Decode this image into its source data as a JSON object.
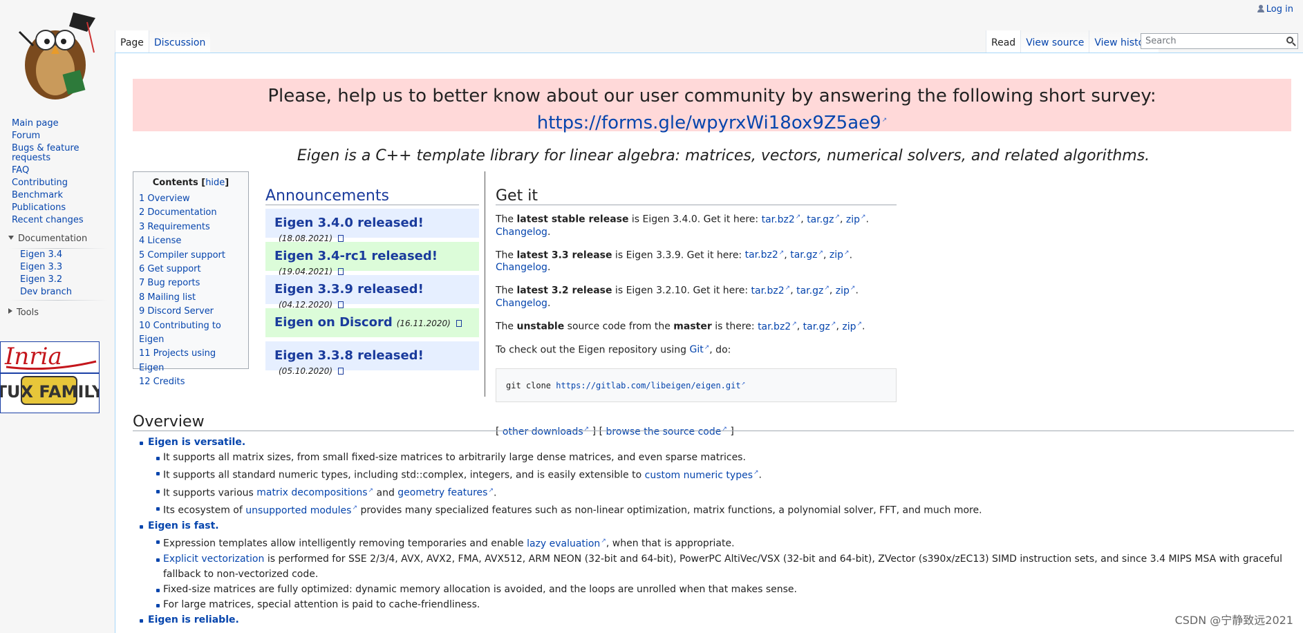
{
  "personal": {
    "login": "Log in"
  },
  "sidebar": {
    "nav": [
      "Main page",
      "Forum",
      "Bugs & feature requests",
      "FAQ",
      "Contributing",
      "Benchmark",
      "Publications",
      "Recent changes"
    ],
    "documentation_label": "Documentation",
    "documentation_items": [
      "Eigen 3.4",
      "Eigen 3.3",
      "Eigen 3.2",
      "Dev branch"
    ],
    "tools_label": "Tools",
    "sponsor1": "Inria",
    "sponsor2": "TUX FAMILY"
  },
  "tabs": {
    "left": [
      "Page",
      "Discussion"
    ],
    "right": [
      "Read",
      "View source",
      "View history"
    ]
  },
  "search": {
    "placeholder": "Search"
  },
  "survey": {
    "question": "Please, help us to better know about our user community by answering the following short survey:",
    "url": "https://forms.gle/wpyrxWi18ox9Z5ae9"
  },
  "tagline": "Eigen is a C++ template library for linear algebra: matrices, vectors, numerical solvers, and related algorithms.",
  "toc": {
    "title": "Contents",
    "hide": "hide",
    "items": [
      "1 Overview",
      "2 Documentation",
      "3 Requirements",
      "4 License",
      "5 Compiler support",
      "6 Get support",
      "7 Bug reports",
      "8 Mailing list",
      "9 Discord Server",
      "10 Contributing to Eigen",
      "11 Projects using Eigen",
      "12 Credits"
    ]
  },
  "announcements": {
    "title": "Announcements",
    "items": [
      {
        "label": "Eigen 3.4.0 released!",
        "date": "(18.08.2021)",
        "color": "#e6efff"
      },
      {
        "label": "Eigen 3.4-rc1 released!",
        "date": "(19.04.2021)",
        "color": "#dcfcd9"
      },
      {
        "label": "Eigen 3.3.9 released!",
        "date": "(04.12.2020)",
        "color": "#e6efff"
      },
      {
        "label": "Eigen on Discord",
        "date": "(16.11.2020)",
        "color": "#dcfcd9"
      },
      {
        "label": "Eigen 3.3.8 released!",
        "date": "(05.10.2020)",
        "color": "#e6efff"
      }
    ]
  },
  "getit": {
    "title": "Get it",
    "lines": [
      {
        "pre": "The ",
        "bold": "latest stable release",
        "mid": " is Eigen 3.4.0. Get it here: ",
        "links": [
          "tar.bz2",
          "tar.gz",
          "zip"
        ],
        "end": "Changelog"
      },
      {
        "pre": "The ",
        "bold": "latest 3.3 release",
        "mid": " is Eigen 3.3.9. Get it here: ",
        "links": [
          "tar.bz2",
          "tar.gz",
          "zip"
        ],
        "end": "Changelog"
      },
      {
        "pre": "The ",
        "bold": "latest 3.2 release",
        "mid": " is Eigen 3.2.10. Get it here: ",
        "links": [
          "tar.bz2",
          "tar.gz",
          "zip"
        ],
        "end": "Changelog"
      }
    ],
    "unstable": {
      "pre": "The ",
      "bold1": "unstable",
      "mid1": " source code from the ",
      "bold2": "master",
      "mid2": " is there: ",
      "links": [
        "tar.bz2",
        "tar.gz",
        "zip"
      ]
    },
    "checkout_pre": "To check out the Eigen repository using ",
    "checkout_link": "Git",
    "checkout_post": ", do:",
    "git_cmd": "git clone ",
    "git_url": "https://gitlab.com/libeigen/eigen.git",
    "other_downloads": "other downloads",
    "browse_source": "browse the source code"
  },
  "overview": {
    "title": "Overview",
    "versatile": {
      "head": "Eigen is versatile.",
      "i1": "It supports all matrix sizes, from small fixed-size matrices to arbitrarily large dense matrices, and even sparse matrices.",
      "i2_pre": "It supports all standard numeric types, including std::complex, integers, and is easily extensible to ",
      "i2_link": "custom numeric types",
      "i3_pre": "It supports various ",
      "i3_link1": "matrix decompositions",
      "i3_mid": " and ",
      "i3_link2": "geometry features",
      "i4_pre": "Its ecosystem of ",
      "i4_link": "unsupported modules",
      "i4_post": " provides many specialized features such as non-linear optimization, matrix functions, a polynomial solver, FFT, and much more."
    },
    "fast": {
      "head": "Eigen is fast.",
      "i1_pre": "Expression templates allow intelligently removing temporaries and enable ",
      "i1_link": "lazy evaluation",
      "i1_post": ", when that is appropriate.",
      "i2_link": "Explicit vectorization",
      "i2_post": " is performed for SSE 2/3/4, AVX, AVX2, FMA, AVX512, ARM NEON (32-bit and 64-bit), PowerPC AltiVec/VSX (32-bit and 64-bit), ZVector (s390x/zEC13) SIMD instruction sets, and since 3.4 MIPS MSA with graceful fallback to non-vectorized code.",
      "i3": "Fixed-size matrices are fully optimized: dynamic memory allocation is avoided, and the loops are unrolled when that makes sense.",
      "i4": "For large matrices, special attention is paid to cache-friendliness."
    },
    "reliable": {
      "head": "Eigen is reliable."
    }
  },
  "watermark": "CSDN @宁静致远2021"
}
